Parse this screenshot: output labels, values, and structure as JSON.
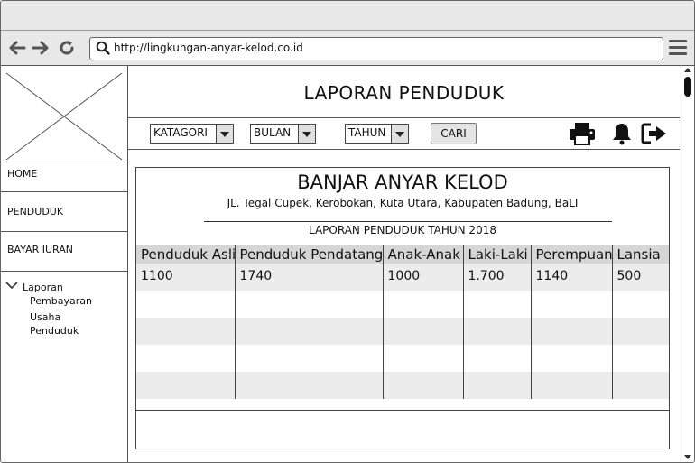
{
  "browser": {
    "url": "http://lingkungan-anyar-kelod.co.id",
    "icons": [
      "back-icon",
      "forward-icon",
      "reload-icon",
      "search-icon",
      "hamburger-menu-icon"
    ]
  },
  "sidebar": {
    "logo": "image-placeholder",
    "items": [
      {
        "label": "HOME"
      },
      {
        "label": "PENDUDUK"
      },
      {
        "label": "BAYAR IURAN"
      }
    ],
    "tree": {
      "label": "Laporan",
      "children": [
        {
          "line1": "Pembayaran"
        },
        {
          "line1": "Usaha",
          "line2": "Penduduk"
        }
      ]
    }
  },
  "header": {
    "title": "LAPORAN PENDUDUK"
  },
  "filters": {
    "kategori": "KATAGORI",
    "bulan": "BULAN",
    "tahun": "TAHUN",
    "search_button": "CARI",
    "icons": [
      "print-icon",
      "bell-icon",
      "logout-icon"
    ]
  },
  "report": {
    "title": "BANJAR ANYAR KELOD",
    "address": "JL. Tegal Cupek, Kerobokan, Kuta Utara, Kabupaten Badung, BaLI",
    "subtitle": "LAPORAN PENDUDUK TAHUN 2018",
    "columns": [
      "Penduduk Asli",
      "Penduduk Pendatang",
      "Anak-Anak",
      "Laki-Laki",
      "Perempuan",
      "Lansia"
    ],
    "rows": [
      [
        "1100",
        "1740",
        "1000",
        "1.700",
        "1140",
        "500"
      ],
      [
        "",
        "",
        "",
        "",
        "",
        ""
      ],
      [
        "",
        "",
        "",
        "",
        "",
        ""
      ],
      [
        "",
        "",
        "",
        "",
        "",
        ""
      ],
      [
        "",
        "",
        "",
        "",
        "",
        ""
      ]
    ]
  },
  "colors": {
    "chrome": "#e8e8e8",
    "header_row": "#d6d6d6",
    "stripe": "#ececec",
    "border": "#444444"
  }
}
